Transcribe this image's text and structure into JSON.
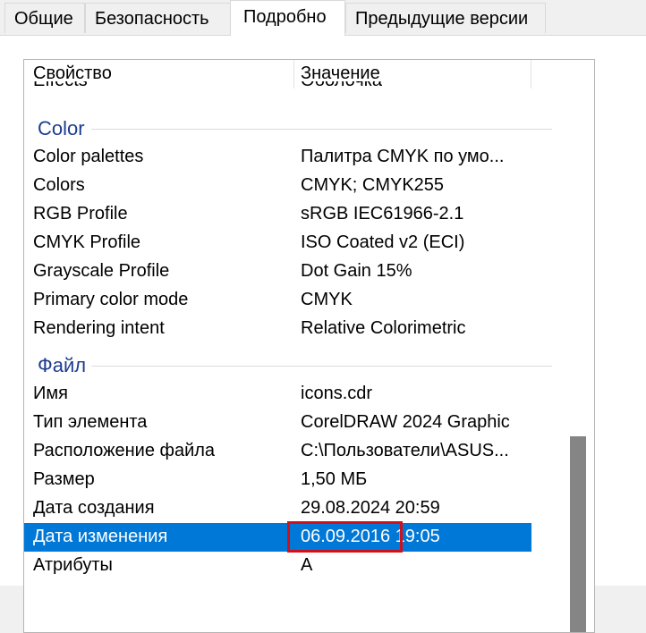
{
  "tabs": [
    "Общие",
    "Безопасность",
    "Подробно",
    "Предыдущие версии"
  ],
  "active_tab": "Подробно",
  "columns": {
    "property": "Свойство",
    "value": "Значение"
  },
  "partial_row": {
    "property": "Effects",
    "value": "Оболочка"
  },
  "groups": [
    {
      "title": "Color",
      "rows": [
        {
          "property": "Color palettes",
          "value": "Палитра CMYK по умо..."
        },
        {
          "property": "Colors",
          "value": "CMYK; CMYK255"
        },
        {
          "property": "RGB Profile",
          "value": "sRGB IEC61966-2.1"
        },
        {
          "property": "CMYK Profile",
          "value": "ISO Coated v2 (ECI)"
        },
        {
          "property": "Grayscale Profile",
          "value": "Dot Gain 15%"
        },
        {
          "property": "Primary color mode",
          "value": "CMYK"
        },
        {
          "property": "Rendering intent",
          "value": "Relative Colorimetric"
        }
      ]
    },
    {
      "title": "Файл",
      "rows": [
        {
          "property": "Имя",
          "value": "icons.cdr"
        },
        {
          "property": "Тип элемента",
          "value": "CorelDRAW 2024 Graphic"
        },
        {
          "property": "Расположение файла",
          "value": "C:\\Пользователи\\ASUS..."
        },
        {
          "property": "Размер",
          "value": "1,50 МБ"
        },
        {
          "property": "Дата создания",
          "value": "29.08.2024 20:59"
        },
        {
          "property": "Дата изменения",
          "value": "06.09.2016 19:05"
        },
        {
          "property": "Атрибуты",
          "value": "A"
        }
      ]
    }
  ],
  "selected_row": "Дата изменения",
  "colors": {
    "selection": "#0078d7",
    "group_title": "#1e3d8f",
    "highlight_box": "#d0101b"
  }
}
